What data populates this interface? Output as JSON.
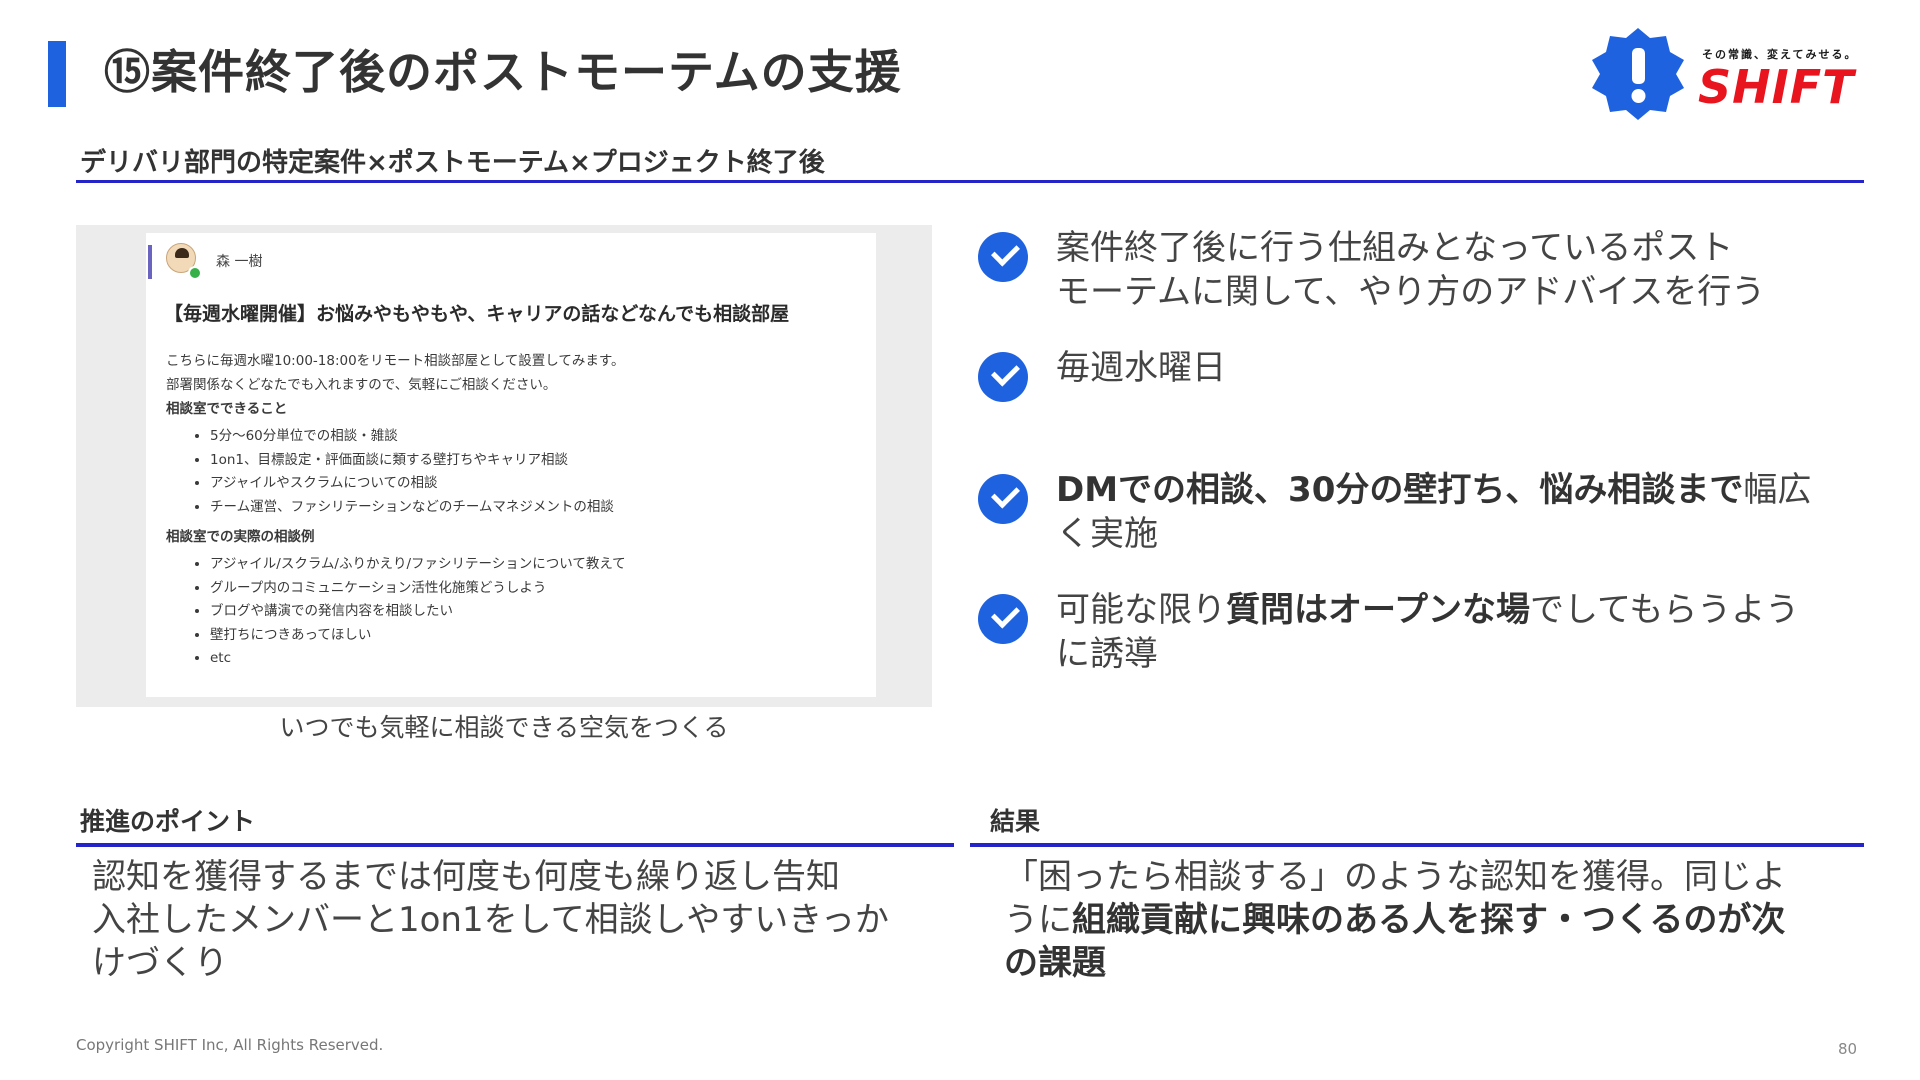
{
  "header": {
    "title": "⑮案件終了後のポストモーテムの支援",
    "subtitle": "デリバリ部門の特定案件×ポストモーテム×プロジェクト終了後"
  },
  "logo": {
    "tagline": "その常識、変えてみせる。",
    "wordmark": "SHIFT"
  },
  "screenshot": {
    "author": "森 一樹",
    "heading": "【毎週水曜開催】お悩みやもやもや、キャリアの話などなんでも相談部屋",
    "intro1": "こちらに毎週水曜10:00-18:00をリモート相談部屋として設置してみます。",
    "intro2": "部署関係なくどなたでも入れますので、気軽にご相談ください。",
    "section1_title": "相談室でできること",
    "section1_items": [
      "5分〜60分単位での相談・雑談",
      "1on1、目標設定・評価面談に類する壁打ちやキャリア相談",
      "アジャイルやスクラムについての相談",
      "チーム運営、ファシリテーションなどのチームマネジメントの相談"
    ],
    "section2_title": "相談室での実際の相談例",
    "section2_items": [
      "アジャイル/スクラム/ふりかえり/ファシリテーションについて教えて",
      "グループ内のコミュニケーション活性化施策どうしよう",
      "ブログや講演での発信内容を相談したい",
      "壁打ちにつきあってほしい",
      "etc"
    ]
  },
  "caption": "いつでも気軽に相談できる空気をつくる",
  "checks": [
    {
      "line1": "案件終了後に行う仕組みとなっているポスト",
      "line2": "モーテムに関して、やり方のアドバイスを行う"
    },
    {
      "text": "毎週水曜日"
    },
    {
      "bold": "DMでの相談、30分の壁打ち、悩み相談まで",
      "rest1": "幅広",
      "rest2": "く実施"
    },
    {
      "pre": "可能な限り",
      "bold": "質問はオープンな場",
      "post1": "でしてもらうよう",
      "post2": "に誘導"
    }
  ],
  "points": {
    "heading": "推進のポイント",
    "line1": "認知を獲得するまでは何度も何度も繰り返し告知",
    "line2": "入社したメンバーと1on1をして相談しやすいきっか",
    "line3": "けづくり"
  },
  "result": {
    "heading": "結果",
    "line1": "「困ったら相談する」のような認知を獲得。同じよ",
    "line2_pre": "うに",
    "line2_bold": "組織貢献に興味のある人を探す・つくるのが次",
    "line3_bold": "の課題"
  },
  "footer": {
    "copyright": "Copyright SHIFT Inc, All Rights Reserved.",
    "page": "80"
  },
  "colors": {
    "accent_blue": "#1f62e0",
    "rule_navy": "#2424c8",
    "logo_red": "#e8141e"
  }
}
